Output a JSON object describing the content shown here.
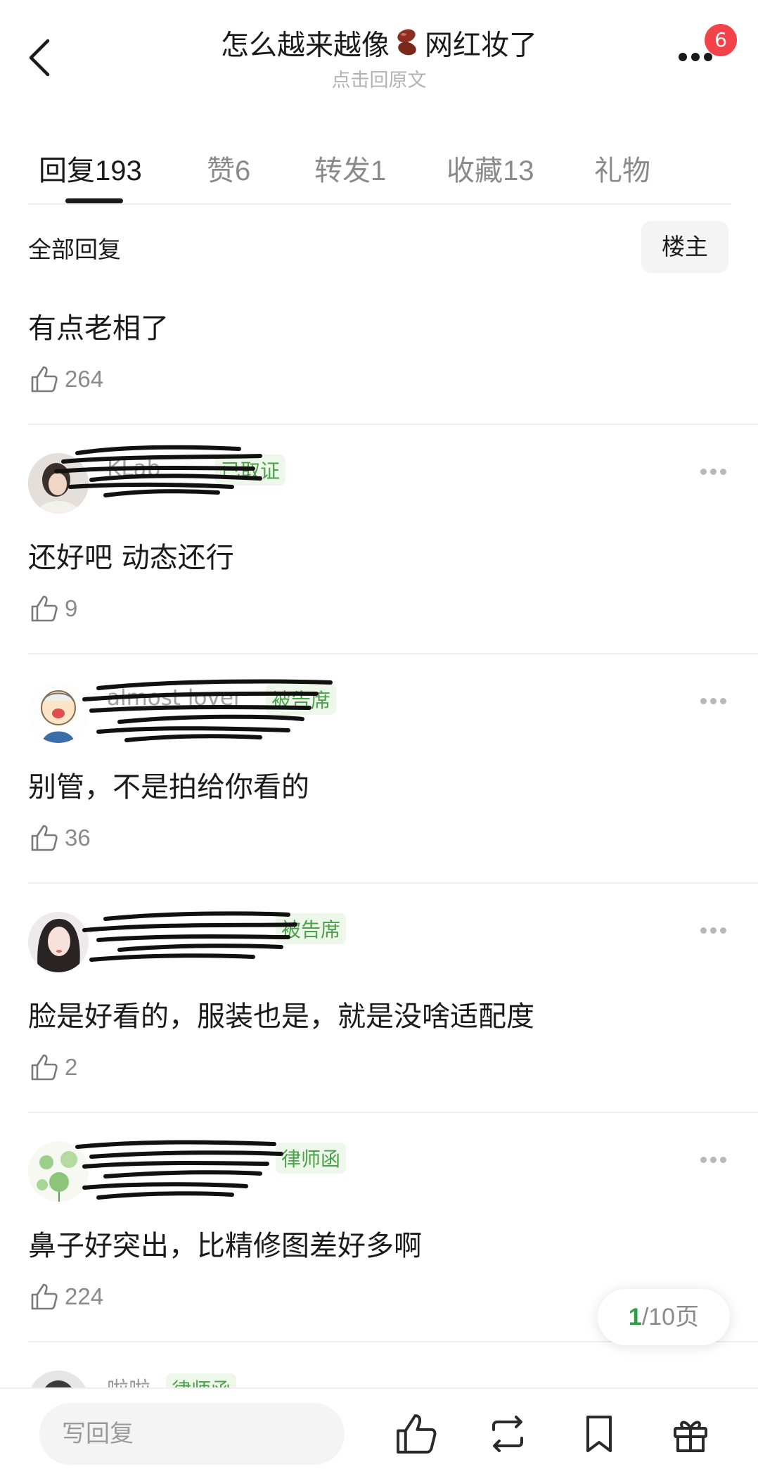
{
  "header": {
    "title_left": "怎么越来越像",
    "title_right": "网红妆了",
    "subtitle": "点击回原文",
    "notification_count": "6"
  },
  "tabs": [
    {
      "label": "回复",
      "count": "193",
      "active": true
    },
    {
      "label": "赞",
      "count": "6",
      "active": false
    },
    {
      "label": "转发",
      "count": "1",
      "active": false
    },
    {
      "label": "收藏",
      "count": "13",
      "active": false
    },
    {
      "label": "礼物",
      "count": "",
      "active": false
    }
  ],
  "section": {
    "title": "全部回复",
    "op_filter": "楼主"
  },
  "comments": [
    {
      "text": "有点老相了",
      "likes": "264"
    },
    {
      "username": "KLab",
      "tag": "已取证",
      "text": "还好吧 动态还行",
      "likes": "9"
    },
    {
      "username": "almost lover",
      "tag": "被告席",
      "text": "别管，不是拍给你看的",
      "likes": "36"
    },
    {
      "tag": "被告席",
      "text": "脸是好看的，服装也是，就是没啥适配度",
      "likes": "2"
    },
    {
      "tag": "律师函",
      "text": "鼻子好突出，比精修图差好多啊",
      "likes": "224"
    },
    {
      "username": "啦啦",
      "tag": "律师函"
    }
  ],
  "pager": {
    "current": "1",
    "total": "/10页"
  },
  "bottom_bar": {
    "reply_placeholder": "写回复"
  },
  "colors": {
    "accent_green": "#4aa14a",
    "badge_red": "#f2424a",
    "pager_green": "#2e9d4a"
  }
}
